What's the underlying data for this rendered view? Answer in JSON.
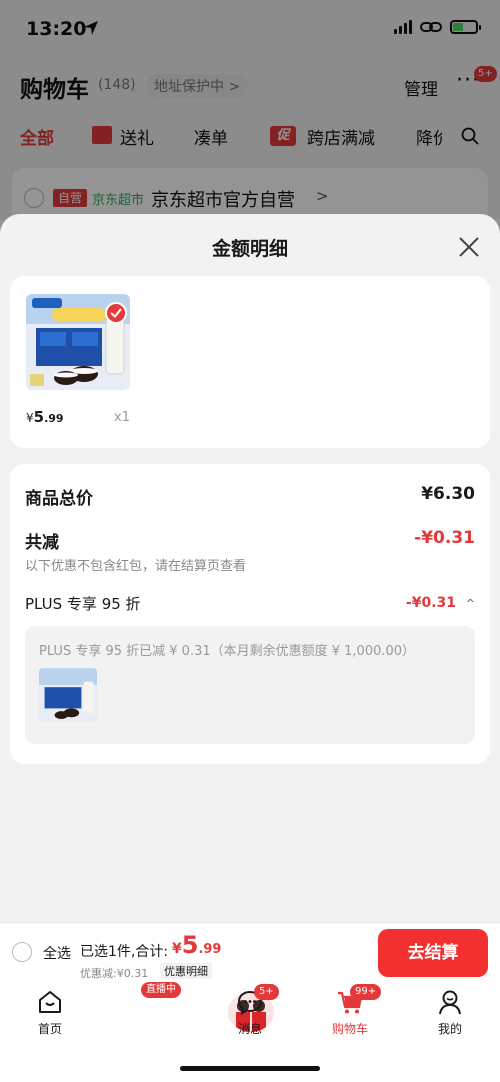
{
  "status_bar": {
    "time": "13:20"
  },
  "header": {
    "title": "购物车",
    "count": "(148)",
    "address_protect": "地址保护中 >",
    "manage": "管理",
    "more": "···",
    "more_badge": "5+"
  },
  "filter_tabs": [
    {
      "label": "全部",
      "active": true
    },
    {
      "label": "送礼"
    },
    {
      "label": "凑单"
    },
    {
      "label": "跨店满减"
    },
    {
      "label": "降价"
    }
  ],
  "promo_icon_text": "促",
  "store": {
    "tag": "自营",
    "market": "京东超市",
    "name": "京东超市官方自营",
    "chevron": ">"
  },
  "sheet": {
    "title": "金额明细",
    "product": {
      "price_symbol": "¥",
      "price_int": "5",
      "price_dec": ".99",
      "quantity": "x1"
    },
    "total_label": "商品总价",
    "total_value": "¥6.30",
    "reduce_label": "共减",
    "reduce_value": "-¥0.31",
    "note": "以下优惠不包含红包，请在结算页查看",
    "plus_label": "PLUS 专享 95 折",
    "plus_value": "-¥0.31",
    "plus_caret": "^",
    "plus_desc": "PLUS 专享 95 折已减 ¥ 0.31（本月剩余优惠额度 ¥ 1,000.00）"
  },
  "settle": {
    "select_all": "全选",
    "selected": "已选1件,合计:",
    "total_symbol": "¥",
    "total_int": "5",
    "total_dec": ".99",
    "discount": "优惠减:¥0.31",
    "detail_link": "优惠明细",
    "checkout": "去结算"
  },
  "tabs": [
    {
      "label": "首页",
      "icon": "home-icon"
    },
    {
      "label": "",
      "icon": "live-avatar",
      "badge": "直播中"
    },
    {
      "label": "消息",
      "icon": "message-icon",
      "badge": "5+"
    },
    {
      "label": "购物车",
      "icon": "cart-icon",
      "badge": "99+",
      "active": true
    },
    {
      "label": "我的",
      "icon": "profile-icon"
    }
  ],
  "colors": {
    "accent": "#e4393c",
    "checkout": "#f23030",
    "green": "#2fae5a"
  }
}
